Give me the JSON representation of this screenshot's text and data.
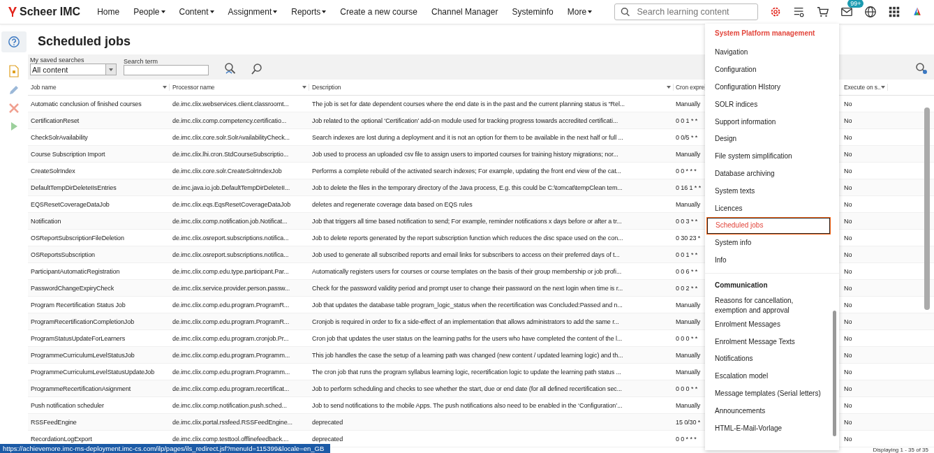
{
  "brand": "Scheer IMC",
  "nav": [
    {
      "label": "Home",
      "dropdown": false
    },
    {
      "label": "People",
      "dropdown": true
    },
    {
      "label": "Content",
      "dropdown": true
    },
    {
      "label": "Assignment",
      "dropdown": true
    },
    {
      "label": "Reports",
      "dropdown": true
    },
    {
      "label": "Create a new course",
      "dropdown": false
    },
    {
      "label": "Channel Manager",
      "dropdown": false
    },
    {
      "label": "Systeminfo",
      "dropdown": false
    },
    {
      "label": "More",
      "dropdown": true
    }
  ],
  "search": {
    "placeholder": "Search learning content"
  },
  "mail_badge": "99+",
  "page_title": "Scheduled jobs",
  "filters": {
    "saved_label": "My saved searches",
    "saved_value": "All content",
    "term_label": "Search term"
  },
  "table": {
    "columns": [
      "Job name",
      "Processor name",
      "Description",
      "Cron expre",
      "Execute on s.."
    ],
    "rows": [
      [
        "Automatic conclusion of finished courses",
        "de.imc.clix.webservices.client.classroomt...",
        "The job is set for date dependent courses where the end date is in the past and the current planning status is “Rel...",
        "Manually",
        "No"
      ],
      [
        "CertificationReset",
        "de.imc.clix.comp.competency.certificatio...",
        "Job related to the optional ‘Certification’ add-on module used for tracking progress towards accredited certificati...",
        "0 0 1 * *",
        "No"
      ],
      [
        "CheckSolrAvailability",
        "de.imc.clix.core.solr.SolrAvailabilityCheck...",
        "Search indexes are lost during a deployment and it is not an option for them to be available in the next half or full ...",
        "0 0/5 * *",
        "No"
      ],
      [
        "Course Subscription Import",
        "de.imc.clix.lhi.cron.StdCourseSubscriptio...",
        "Job used to process an uploaded csv file to assign users to imported courses for training history migrations; nor...",
        "Manually",
        "No"
      ],
      [
        "CreateSolrIndex",
        "de.imc.clix.core.solr.CreateSolrIndexJob",
        "Performs a complete rebuild of the activated search indexes; For example, updating the front end view of the cat...",
        "0 0 * * *",
        "No"
      ],
      [
        "DefaultTempDirDeleteIIsEntries",
        "de.imc.java.io.job.DefaultTempDirDeleteII...",
        "Job to delete the files in the temporary directory of the Java process, E.g. this could be C:\\tomcat\\tempClean tem...",
        "0 16 1 * *",
        "No"
      ],
      [
        "EQSResetCoverageDataJob",
        "de.imc.clix.eqs.EqsResetCoverageDataJob",
        "deletes and regenerate coverage data based on EQS rules",
        "Manually",
        "No"
      ],
      [
        "Notification",
        "de.imc.clix.comp.notification.job.Notificat...",
        "Job that triggers all time based notification to send; For example, reminder notifications x days before or after a tr...",
        "0 0 3 * *",
        "No"
      ],
      [
        "OSReportSubscriptionFileDeletion",
        "de.imc.clix.osreport.subscriptions.notifica...",
        "Job to delete reports generated by the report subscription function which reduces the disc space used on the con...",
        "0 30 23 *",
        "No"
      ],
      [
        "OSReportsSubscription",
        "de.imc.clix.osreport.subscriptions.notifica...",
        "Job used to generate all subscribed reports and email links for subscribers to access on their preferred days of t...",
        "0 0 1 * *",
        "No"
      ],
      [
        "ParticipantAutomaticRegistration",
        "de.imc.clix.comp.edu.type.participant.Par...",
        "Automatically registers users for courses or course templates on the basis of their group membership or job profi...",
        "0 0 6 * *",
        "No"
      ],
      [
        "PasswordChangeExpiryCheck",
        "de.imc.clix.service.provider.person.passw...",
        "Check for the password validity period and prompt user to change their password on the next login when time is r...",
        "0 0 2 * *",
        "No"
      ],
      [
        "Program Recertification Status Job",
        "de.imc.clix.comp.edu.program.ProgramR...",
        "Job that updates the database table program_logic_status when the recertification was Concluded:Passed and n...",
        "Manually",
        "No"
      ],
      [
        "ProgramRecertificationCompletionJob",
        "de.imc.clix.comp.edu.program.ProgramR...",
        "Cronjob is required in order to fix a side-effect of an implementation that allows administrators to add the same r...",
        "Manually",
        "No"
      ],
      [
        "ProgramStatusUpdateForLearners",
        "de.imc.clix.comp.edu.program.cronjob.Pr...",
        "Cron job that updates the user status on the learning paths for the users who have completed the content of the l...",
        "0 0 0 * *",
        "No"
      ],
      [
        "ProgrammeCurriculumLevelStatusJob",
        "de.imc.clix.comp.edu.program.Programm...",
        "This job handles the case the setup of a learning path was changed (new content / updated learning logic) and th...",
        "Manually",
        "No"
      ],
      [
        "ProgrammeCurriculumLevelStatusUpdateJob",
        "de.imc.clix.comp.edu.program.Programm...",
        "The cron job that runs the program syllabus learning logic, recertification logic to update the learning path status ...",
        "Manually",
        "No"
      ],
      [
        "ProgrammeRecertificationAsignment",
        "de.imc.clix.comp.edu.program.recertificat...",
        "Job to perform scheduling and checks to see whether the start, due or end date (for all defined recertification sec...",
        "0 0 0 * *",
        "No"
      ],
      [
        "Push notification scheduler",
        "de.imc.clix.comp.notification.push.sched...",
        "Job to send notifications to the mobile Apps. The push notifications also need to be enabled in the ‘Configuration’...",
        "Manually",
        "No"
      ],
      [
        "RSSFeedEngine",
        "de.imc.clix.portal.rssfeed.RSSFeedEngine...",
        "deprecated",
        "15 0/30 *",
        "No"
      ],
      [
        "RecordationLogExport",
        "de.imc.clix.comp.testtool.offlinefeedback....",
        "deprecated",
        "0 0 * * *",
        "No"
      ]
    ]
  },
  "menu": {
    "sections": [
      {
        "title": "System Platform management",
        "active": true,
        "items": [
          {
            "label": "Navigation",
            "selected": false
          },
          {
            "label": "Configuration",
            "selected": false
          },
          {
            "label": "Configuration HIstory",
            "selected": false
          },
          {
            "label": "SOLR indices",
            "selected": false
          },
          {
            "label": "Support information",
            "selected": false
          },
          {
            "label": "Design",
            "selected": false
          },
          {
            "label": "File system simplification",
            "selected": false
          },
          {
            "label": "Database archiving",
            "selected": false
          },
          {
            "label": "System texts",
            "selected": false
          },
          {
            "label": "Licences",
            "selected": false
          },
          {
            "label": "Scheduled jobs",
            "selected": true
          },
          {
            "label": "System info",
            "selected": false
          },
          {
            "label": "Info",
            "selected": false
          }
        ]
      },
      {
        "title": "Communication",
        "active": false,
        "items": [
          {
            "label": "Reasons for cancellation, exemption and approval",
            "selected": false
          },
          {
            "label": "Enrolment Messages",
            "selected": false
          },
          {
            "label": "Enrolment Message Texts",
            "selected": false
          },
          {
            "label": "Notifications",
            "selected": false
          },
          {
            "label": "Escalation model",
            "selected": false
          },
          {
            "label": "Message templates (Serial letters)",
            "selected": false
          },
          {
            "label": "Announcements",
            "selected": false
          },
          {
            "label": "HTML-E-Mail-Vorlage",
            "selected": false
          }
        ]
      }
    ]
  },
  "paging": "Displaying 1 - 35 of 35",
  "status_url": "https://achievemore.imc-ms-deployment.imc-cs.com/ilp/pages/ils_redirect.jsf?menuId=115399&locale=en_GB"
}
